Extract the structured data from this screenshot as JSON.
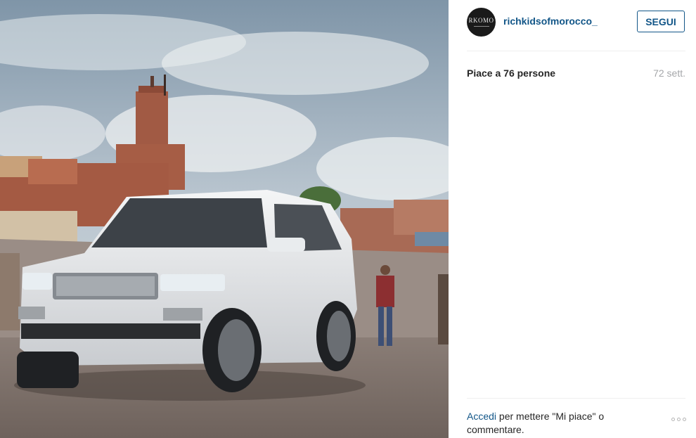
{
  "post": {
    "username": "richkidsofmorocco_",
    "avatar_text": "RKOMO",
    "follow_label": "SEGUI",
    "likes_text": "Piace a 76 persone",
    "timestamp": "72 sett.",
    "login_link": "Accedi",
    "login_prompt": " per mettere \"Mi piace\" o commentare.",
    "photo_alt": "white suv in marketplace"
  },
  "colors": {
    "link": "#125688",
    "text": "#262626",
    "muted": "#a5a7aa"
  },
  "icons": {
    "more": "ellipsis-icon"
  }
}
